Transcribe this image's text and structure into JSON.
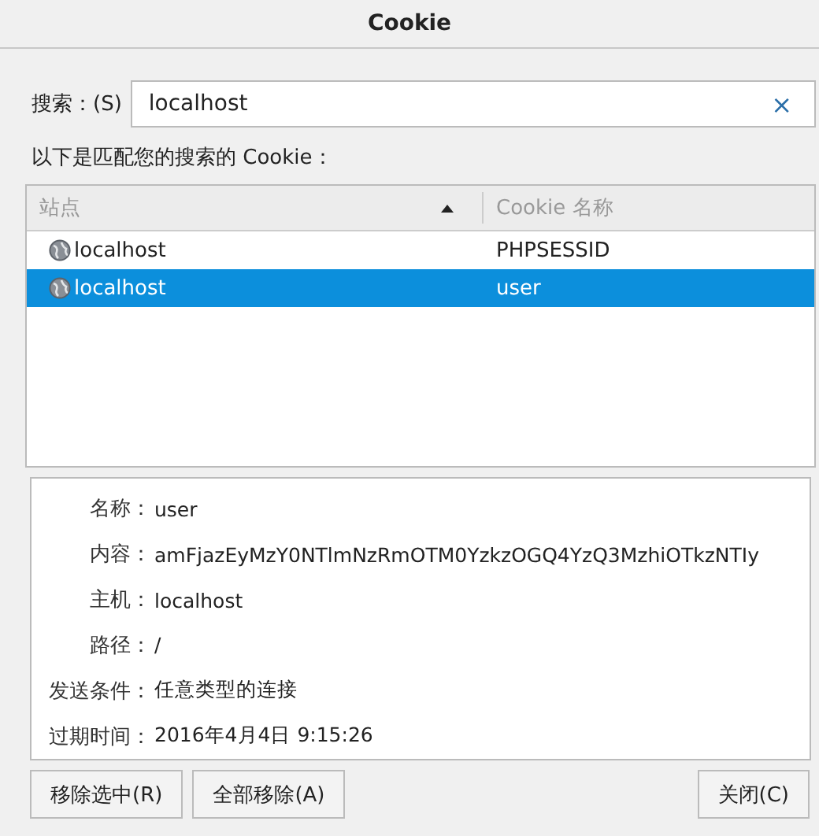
{
  "window": {
    "title": "Cookie"
  },
  "search": {
    "label": "搜索：(S)",
    "value": "localhost",
    "clear": "×"
  },
  "results_label": "以下是匹配您的搜索的 Cookie：",
  "table": {
    "columns": [
      {
        "label": "站点",
        "sorted": true
      },
      {
        "label": "Cookie 名称",
        "sorted": false
      }
    ],
    "rows": [
      {
        "site": "localhost",
        "name": "PHPSESSID",
        "selected": false
      },
      {
        "site": "localhost",
        "name": "user",
        "selected": true
      }
    ]
  },
  "details": [
    {
      "label": "名称：",
      "value": "user"
    },
    {
      "label": "内容：",
      "value": "amFjazEyMzY0NTlmNzRmOTM0YzkzOGQ4YzQ3MzhiOTkzNTIy"
    },
    {
      "label": "主机：",
      "value": "localhost"
    },
    {
      "label": "路径：",
      "value": "/"
    },
    {
      "label": "发送条件：",
      "value": "任意类型的连接"
    },
    {
      "label": "过期时间：",
      "value": "2016年4月4日 9:15:26"
    }
  ],
  "buttons": {
    "left": [
      "移除选中(R)",
      "全部移除(A)"
    ],
    "right": [
      "关闭(C)"
    ]
  }
}
